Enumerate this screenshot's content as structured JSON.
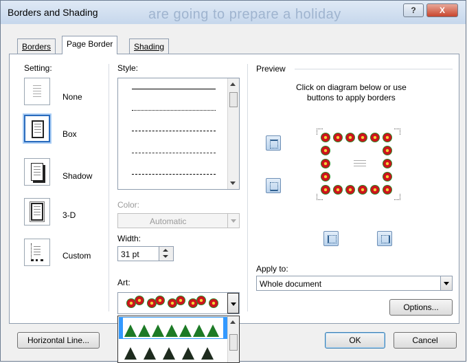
{
  "dialog": {
    "title": "Borders and Shading",
    "background_text": "are going to prepare a holiday",
    "help_glyph": "?",
    "close_glyph": "X"
  },
  "tabs": [
    {
      "label": "Borders",
      "active": false
    },
    {
      "label": "Page Border",
      "active": true
    },
    {
      "label": "Shading",
      "active": false
    }
  ],
  "setting": {
    "label": "Setting:",
    "options": [
      {
        "label": "None",
        "selected": false
      },
      {
        "label": "Box",
        "selected": true
      },
      {
        "label": "Shadow",
        "selected": false
      },
      {
        "label": "3-D",
        "selected": false
      },
      {
        "label": "Custom",
        "selected": false
      }
    ]
  },
  "style": {
    "label": "Style:",
    "line_styles": [
      "solid",
      "dotted",
      "fine-dashed",
      "dashed",
      "dash-dot"
    ]
  },
  "color": {
    "label": "Color:",
    "value": "Automatic",
    "enabled": false
  },
  "width": {
    "label": "Width:",
    "value": "31 pt"
  },
  "art": {
    "label": "Art:",
    "selected": "poinsettia",
    "list_items": [
      "green-trees",
      "dark-trees"
    ]
  },
  "preview": {
    "label": "Preview",
    "instructions_line1": "Click on diagram below or use",
    "instructions_line2": "buttons to apply borders"
  },
  "apply_to": {
    "label": "Apply to:",
    "value": "Whole document"
  },
  "buttons": {
    "options": "Options...",
    "horizontal_line": "Horizontal Line...",
    "ok": "OK",
    "cancel": "Cancel"
  },
  "colors": {
    "accent": "#2a6bbd",
    "poinsettia_red": "#d3141c",
    "tree_green": "#1d7a26"
  }
}
